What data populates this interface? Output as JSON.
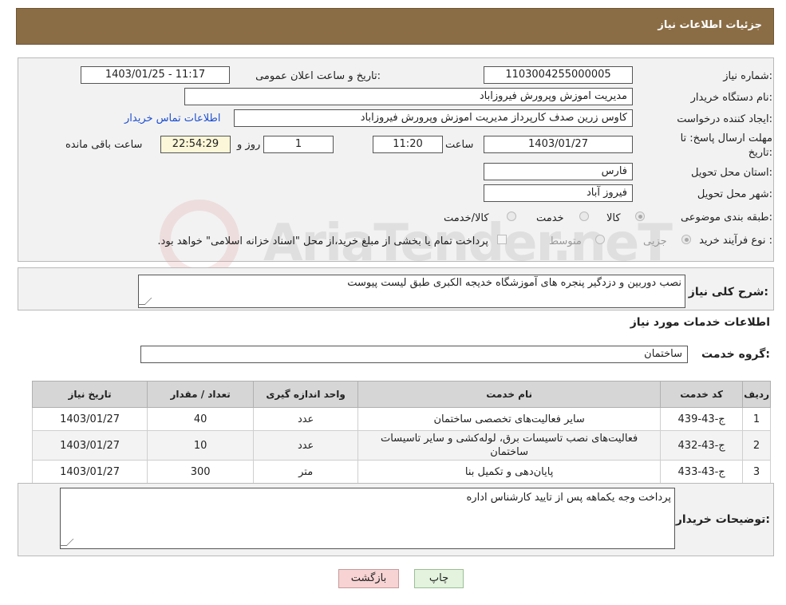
{
  "header": {
    "title": "جزئیات اطلاعات نیاز"
  },
  "form": {
    "need_number_label": "شماره نیاز:",
    "need_number": "1103004255000005",
    "announce_label": "تاریخ و ساعت اعلان عمومی:",
    "announce_value": "1403/01/25 - 11:17",
    "buyer_org_label": "نام دستگاه خریدار:",
    "buyer_org": "مدیریت اموزش وپرورش فیروزاباد",
    "creator_label": "ایجاد کننده درخواست:",
    "creator": "کاوس زرین صدف کارپرداز مدیریت اموزش وپرورش فیروزاباد",
    "contact_link": "اطلاعات تماس خریدار",
    "deadline_label_1": "مهلت ارسال پاسخ: تا",
    "deadline_label_2": "تاریخ:",
    "deadline_date": "1403/01/27",
    "time_label": "ساعت",
    "deadline_time": "11:20",
    "days_value": "1",
    "days_label": "روز و",
    "remaining_time": "22:54:29",
    "remaining_label": "ساعت باقی مانده",
    "province_label": "استان محل تحویل:",
    "province": "فارس",
    "city_label": "شهر محل تحویل:",
    "city": "فیروز آباد",
    "category_label": "طبقه بندی موضوعی:",
    "category_options": [
      "کالا",
      "خدمت",
      "کالا/خدمت"
    ],
    "purchase_type_label": "نوع فرآیند خرید :",
    "purchase_options": [
      "جزیی",
      "متوسط"
    ],
    "payment_note": "پرداخت تمام یا بخشی از مبلغ خرید،از محل \"اسناد خزانه اسلامی\" خواهد بود."
  },
  "summary": {
    "label": "شرح کلی نیاز:",
    "value": "نصب دوربین و دزدگیر پنجره های آموزشگاه خدیجه الکبری طبق لیست پیوست"
  },
  "services": {
    "section_title": "اطلاعات خدمات مورد نیاز",
    "group_label": "گروه خدمت:",
    "group_value": "ساختمان",
    "columns": [
      "ردیف",
      "کد خدمت",
      "نام خدمت",
      "واحد اندازه گیری",
      "تعداد / مقدار",
      "تاریخ نیاز"
    ],
    "rows": [
      [
        "1",
        "ج-43-439",
        "سایر فعالیت‌های تخصصی ساختمان",
        "عدد",
        "40",
        "1403/01/27"
      ],
      [
        "2",
        "ج-43-432",
        "فعالیت‌های نصب تاسیسات برق، لوله‌کشی و سایر تاسیسات ساختمان",
        "عدد",
        "10",
        "1403/01/27"
      ],
      [
        "3",
        "ج-43-433",
        "پایان‌دهی و تکمیل بنا",
        "متر",
        "300",
        "1403/01/27"
      ]
    ]
  },
  "buyer_notes": {
    "label": "توضیحات خریدار:",
    "value": "پرداخت وجه یکماهه پس از تایید کارشناس اداره"
  },
  "buttons": {
    "print": "چاپ",
    "back": "بازگشت"
  },
  "watermark": "AriaTender.neT",
  "colors": {
    "header": "#8b6d45",
    "link": "#1d4fd0",
    "back_button": "#f7d3d3",
    "print_button": "#e3f3de"
  }
}
